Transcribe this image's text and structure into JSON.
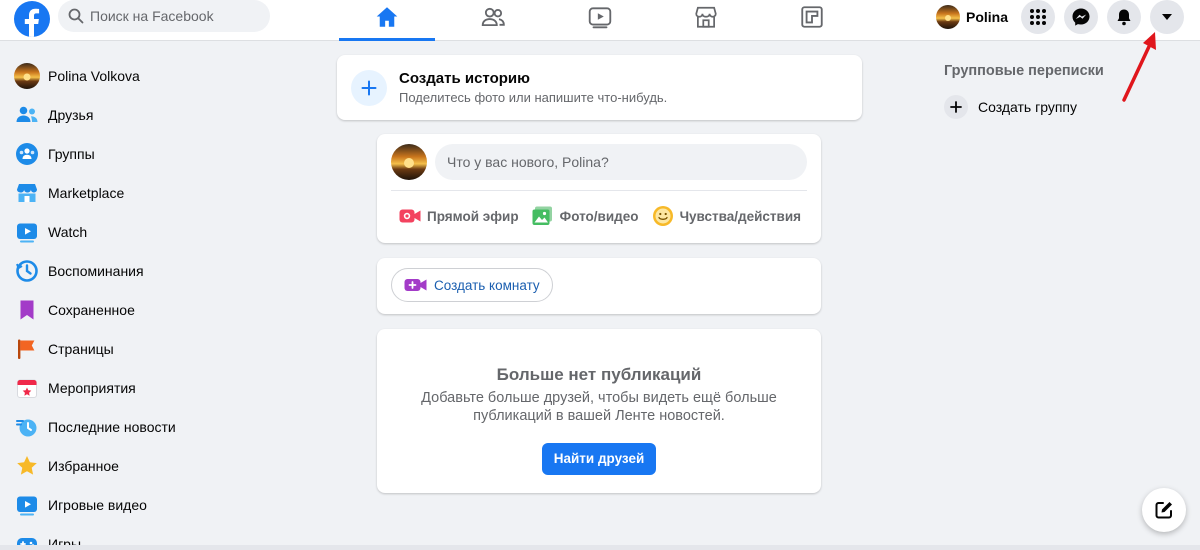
{
  "header": {
    "search_placeholder": "Поиск на Facebook",
    "nav_tabs": [
      {
        "name": "home",
        "active": true
      },
      {
        "name": "friends",
        "active": false
      },
      {
        "name": "watch",
        "active": false
      },
      {
        "name": "marketplace",
        "active": false
      },
      {
        "name": "gaming",
        "active": false
      }
    ],
    "profile_name": "Polina",
    "buttons": [
      "menu-grid-icon",
      "messenger-icon",
      "bell-icon",
      "caret-down-icon"
    ]
  },
  "sidebar": {
    "items": [
      {
        "label": "Polina Volkova",
        "icon": "avatar"
      },
      {
        "label": "Друзья",
        "icon": "friends-icon"
      },
      {
        "label": "Группы",
        "icon": "groups-icon"
      },
      {
        "label": "Marketplace",
        "icon": "marketplace-icon"
      },
      {
        "label": "Watch",
        "icon": "watch-icon"
      },
      {
        "label": "Воспоминания",
        "icon": "memories-icon"
      },
      {
        "label": "Сохраненное",
        "icon": "saved-icon"
      },
      {
        "label": "Страницы",
        "icon": "pages-icon"
      },
      {
        "label": "Мероприятия",
        "icon": "events-icon"
      },
      {
        "label": "Последние новости",
        "icon": "recent-news-icon"
      },
      {
        "label": "Избранное",
        "icon": "favorites-icon"
      },
      {
        "label": "Игровые видео",
        "icon": "gaming-video-icon"
      },
      {
        "label": "Игры",
        "icon": "games-icon"
      }
    ]
  },
  "feed": {
    "story": {
      "title": "Создать историю",
      "subtitle": "Поделитесь фото или напишите что-нибудь."
    },
    "composer": {
      "placeholder": "Что у вас нового, Polina?",
      "actions": [
        "Прямой эфир",
        "Фото/видео",
        "Чувства/действия"
      ]
    },
    "room_button": "Создать комнату",
    "empty": {
      "title": "Больше нет публикаций",
      "text": "Добавьте больше друзей, чтобы видеть ещё больше публикаций в вашей Ленте новостей.",
      "button": "Найти друзей"
    }
  },
  "right": {
    "title": "Групповые переписки",
    "create_group": "Создать группу"
  },
  "colors": {
    "brand": "#1877f2",
    "background": "#f0f2f5",
    "annotation_arrow": "#e0161c"
  }
}
